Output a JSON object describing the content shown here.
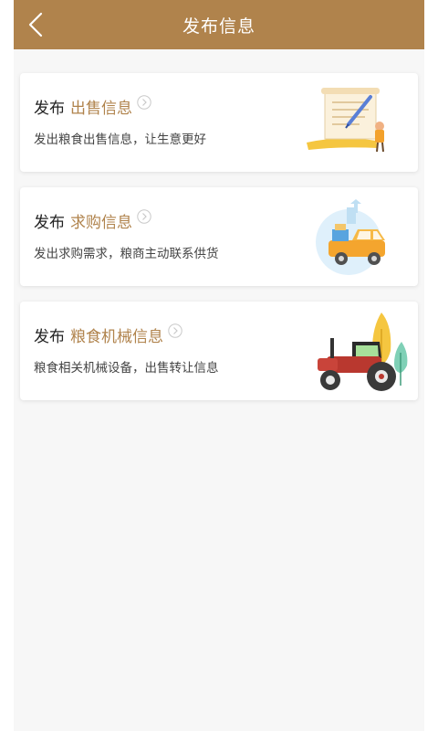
{
  "header": {
    "title": "发布信息",
    "back_icon": "chevron-left-icon"
  },
  "cards": [
    {
      "prefix": "发布",
      "highlight": "出售信息",
      "desc": "发出粮食出售信息，让生意更好",
      "illustration": "document-pen-illustration"
    },
    {
      "prefix": "发布",
      "highlight": "求购信息",
      "desc": "发出求购需求，粮商主动联系供货",
      "illustration": "delivery-truck-illustration"
    },
    {
      "prefix": "发布",
      "highlight": "粮食机械信息",
      "desc": "粮食相关机械设备，出售转让信息",
      "illustration": "tractor-illustration"
    }
  ],
  "colors": {
    "brand": "#b0834c",
    "background": "#f7f7f7",
    "card": "#ffffff"
  }
}
